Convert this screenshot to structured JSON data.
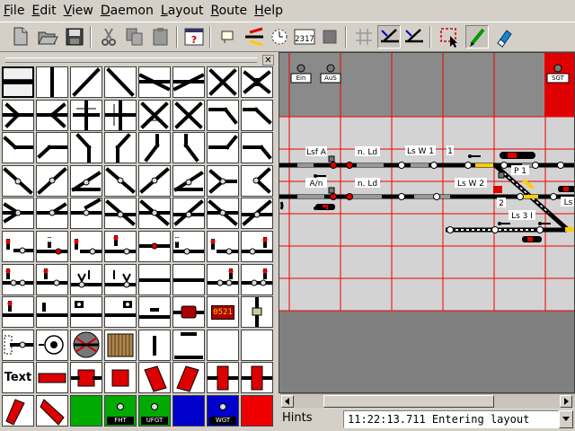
{
  "menubar": {
    "items": [
      {
        "label": "File",
        "u": "F",
        "rest": "ile"
      },
      {
        "label": "Edit",
        "u": "E",
        "rest": "dit"
      },
      {
        "label": "View",
        "u": "V",
        "rest": "iew"
      },
      {
        "label": "Daemon",
        "u": "D",
        "rest": "aemon"
      },
      {
        "label": "Layout",
        "u": "L",
        "rest": "ayout"
      },
      {
        "label": "Route",
        "u": "R",
        "rest": "oute"
      },
      {
        "label": "Help",
        "u": "H",
        "rest": "elp"
      }
    ]
  },
  "toolbar": {
    "buttons": [
      "new-icon",
      "open-icon",
      "save-icon",
      "cut-icon",
      "copy-icon",
      "paste-icon",
      "properties-icon",
      "tooltip-icon",
      "rail-icon",
      "clock-icon",
      "counter-icon",
      "stop-icon",
      "grid-icon",
      "edit-track-icon",
      "edit-switch-icon",
      "select-icon",
      "pen-icon",
      "eraser-icon"
    ],
    "counter_label": "2317"
  },
  "palette": {
    "text_label": "Text",
    "labels": {
      "fht": "FHT",
      "ufgt": "UFGT",
      "wgt": "WGT",
      "display": "0521"
    }
  },
  "layout": {
    "labels": {
      "ein": "Ein",
      "aus": "AuS",
      "sgt": "SGT",
      "lsf_a": "Lsf A",
      "n_ld_1": "n. Ld",
      "ls_w1": "Ls W 1",
      "n1": "1",
      "an": "A/n",
      "n_ld_2": "n. Ld",
      "ls_w2": "Ls W 2",
      "p1": "P 1",
      "n2": "2",
      "ls3": "Ls 3 I",
      "ls_edge": "Ls"
    }
  },
  "statusbar": {
    "hints_label": "Hints",
    "message": "11:22:13.711 Entering layout"
  }
}
